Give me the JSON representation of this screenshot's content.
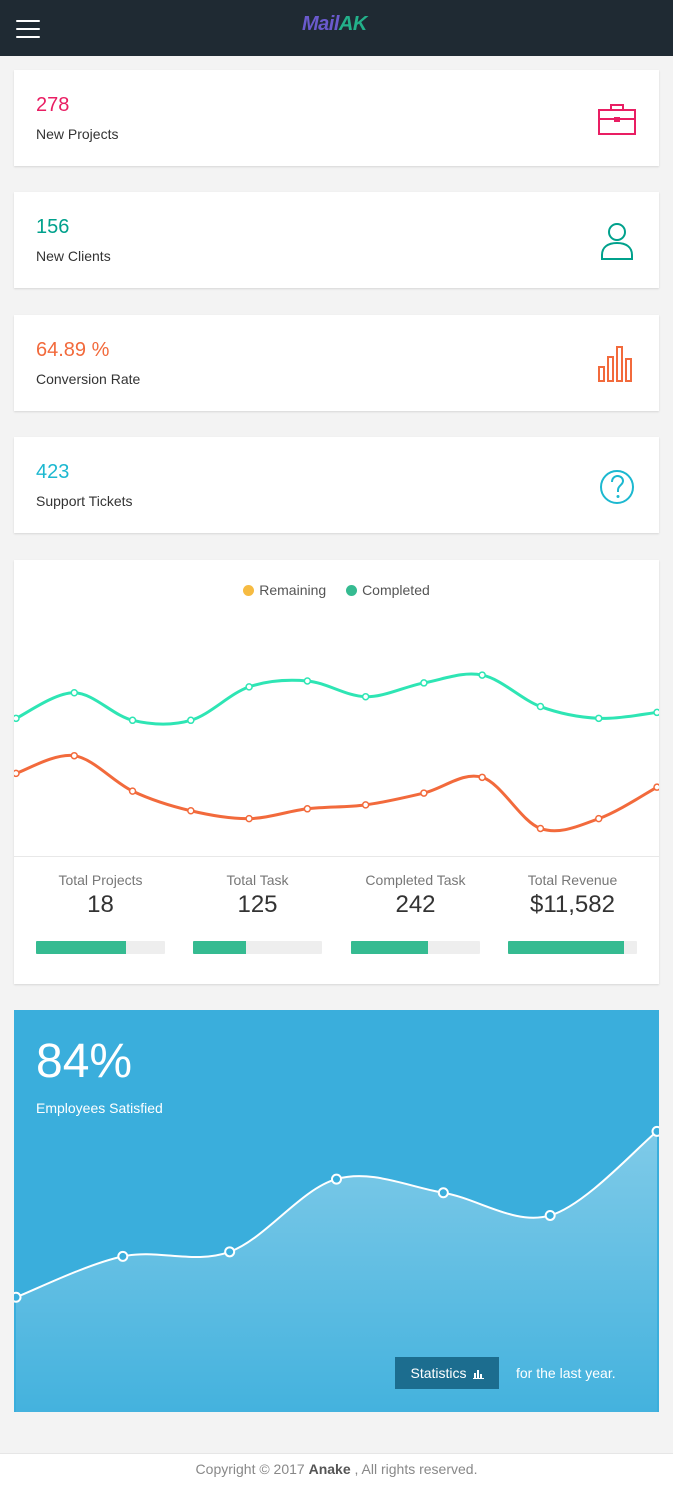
{
  "header": {
    "logo_part1": "Mail",
    "logo_part2": "AK",
    "menu_icon": "hamburger-menu-icon"
  },
  "stats": [
    {
      "value": "278",
      "label": "New Projects",
      "icon": "briefcase-icon",
      "color": "#e91e63"
    },
    {
      "value": "156",
      "label": "New Clients",
      "icon": "user-icon",
      "color": "#00a18c"
    },
    {
      "value": "64.89 %",
      "label": "Conversion Rate",
      "icon": "bar-chart-icon",
      "color": "#f26a3c"
    },
    {
      "value": "423",
      "label": "Support Tickets",
      "icon": "question-circle-icon",
      "color": "#1cb8d0"
    }
  ],
  "chart_data": {
    "type": "line",
    "x": [
      1,
      2,
      3,
      4,
      5,
      6,
      7,
      8,
      9,
      10,
      11,
      12
    ],
    "series": [
      {
        "name": "Remaining",
        "color": "#f26a3c",
        "values": [
          42,
          51,
          33,
          23,
          19,
          24,
          26,
          32,
          40,
          14,
          19,
          35
        ]
      },
      {
        "name": "Completed",
        "color": "#2ee5b4",
        "values": [
          70,
          83,
          69,
          69,
          86,
          89,
          81,
          88,
          92,
          76,
          70,
          73
        ]
      }
    ],
    "legend": {
      "position": "top-center"
    },
    "ylim": [
      0,
      120
    ],
    "grid": false
  },
  "legend": {
    "remaining": {
      "label": "Remaining",
      "color": "#f6bb42"
    },
    "completed": {
      "label": "Completed",
      "color": "#35bb91"
    }
  },
  "metrics": [
    {
      "label": "Total Projects",
      "value": "18",
      "progress": 0.7
    },
    {
      "label": "Total Task",
      "value": "125",
      "progress": 0.41
    },
    {
      "label": "Completed Task",
      "value": "242",
      "progress": 0.6
    },
    {
      "label": "Total Revenue",
      "value": "$11,582",
      "progress": 0.9
    }
  ],
  "satisfaction": {
    "percent": "84%",
    "label": "Employees Satisfied",
    "button_label": "Statistics",
    "button_icon": "bar-chart-icon",
    "period_text": "for the last year.",
    "chart_data": {
      "type": "area",
      "x": [
        1,
        2,
        3,
        4,
        5,
        6,
        7
      ],
      "values": [
        32,
        50,
        52,
        84,
        78,
        68,
        105
      ],
      "ylim": [
        0,
        110
      ]
    }
  },
  "footer": {
    "prefix": "Copyright © 2017",
    "company": "Anake",
    "suffix": ", All rights reserved."
  }
}
